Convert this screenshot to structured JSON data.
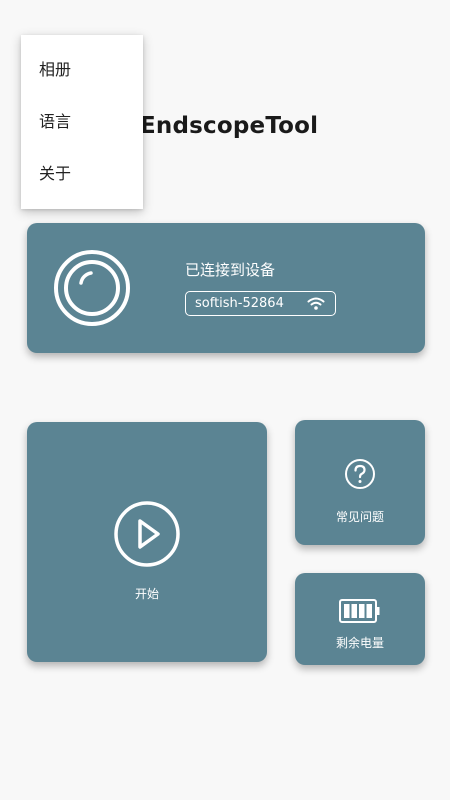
{
  "header": {
    "title": "EndscopeTool"
  },
  "menu": {
    "items": [
      {
        "label": "相册"
      },
      {
        "label": "语言"
      },
      {
        "label": "关于"
      }
    ]
  },
  "device": {
    "status": "已连接到设备",
    "ssid": "softish-52864",
    "icons": [
      "camera-lens-icon",
      "wifi-icon"
    ]
  },
  "actions": {
    "start_label": "开始",
    "faq_label": "常见问题",
    "battery_label": "剩余电量",
    "battery_level_bars": 4,
    "battery_total_bars": 4
  },
  "colors": {
    "card": "#5b8493",
    "background": "#f8f8f8",
    "icon": "#ffffff"
  }
}
